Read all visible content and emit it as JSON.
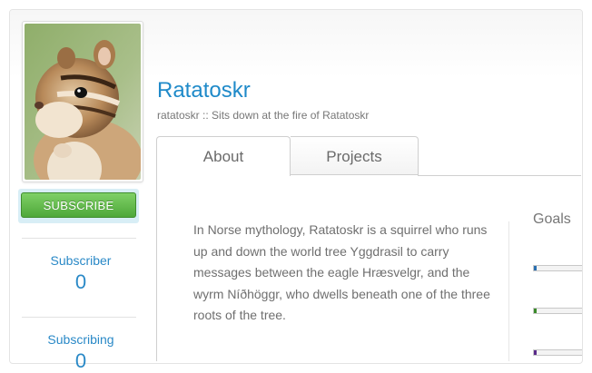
{
  "profile": {
    "name": "Ratatoskr",
    "tagline": "ratatoskr :: Sits down at the fire of Ratatoskr",
    "subscribe_label": "SUBSCRIBE"
  },
  "stats": {
    "subscriber_label": "Subscriber",
    "subscriber_count": "0",
    "subscribing_label": "Subscribing",
    "subscribing_count": "0"
  },
  "tabs": [
    {
      "label": "About",
      "active": true
    },
    {
      "label": "Projects",
      "active": false
    }
  ],
  "about": {
    "text": "In Norse mythology, Ratatoskr is a squirrel who runs up and down the world tree Yggdrasil to carry messages between the eagle Hræsvelgr, and the wyrm Níðhöggr, who dwells beneath one of the three roots of the tree."
  },
  "goals": {
    "title": "Goals",
    "items": [
      {
        "color": "#2a6fb0",
        "progress": 0.06
      },
      {
        "color": "#3a8a2a",
        "progress": 0.06
      },
      {
        "color": "#5a2a8a",
        "progress": 0.06
      }
    ]
  },
  "colors": {
    "accent": "#1f8ac9",
    "subscribe_green": "#4ea83a"
  }
}
